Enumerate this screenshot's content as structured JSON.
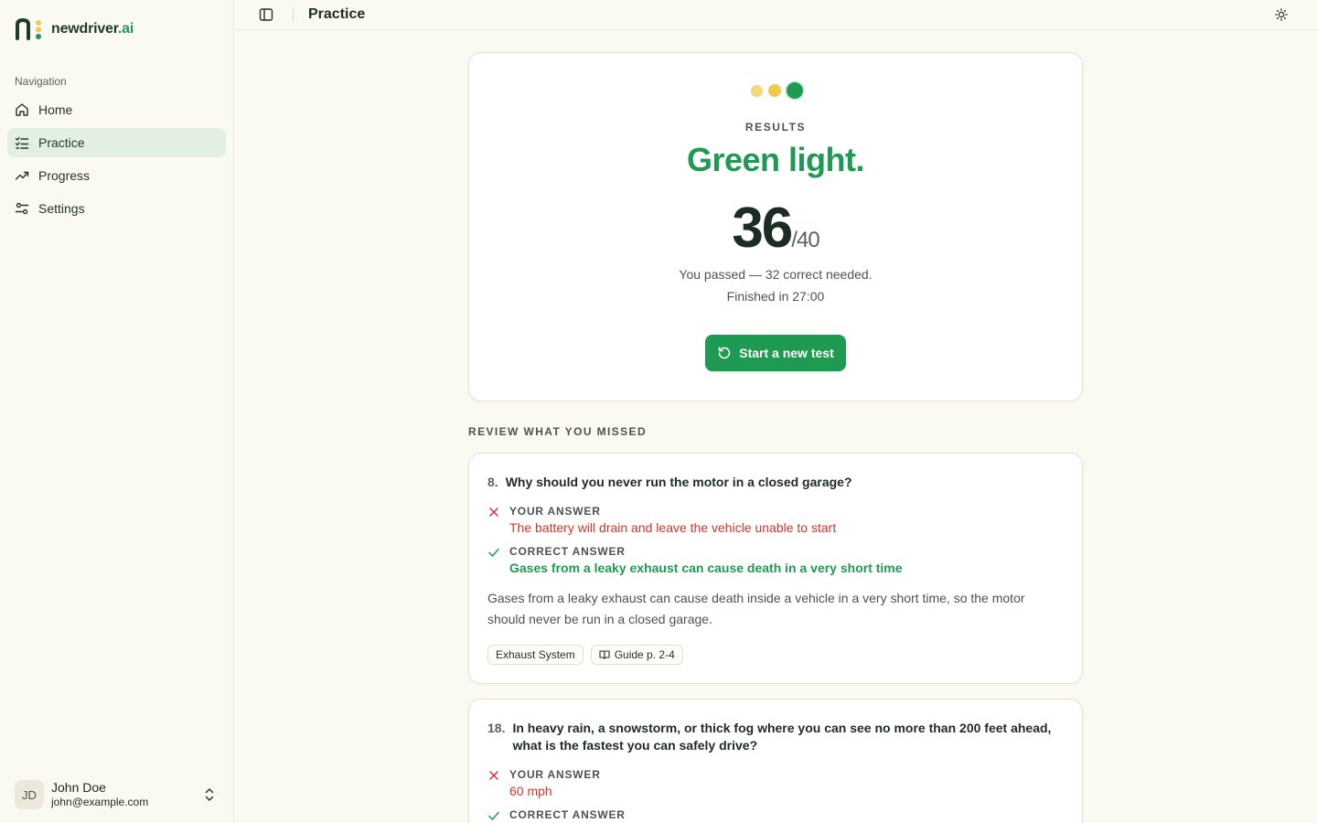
{
  "brand": {
    "name_main": "newdriver",
    "name_suffix": ".ai"
  },
  "sidebar": {
    "heading": "Navigation",
    "items": [
      {
        "label": "Home",
        "icon": "home-icon"
      },
      {
        "label": "Practice",
        "icon": "list-check-icon",
        "active": true
      },
      {
        "label": "Progress",
        "icon": "trending-up-icon"
      },
      {
        "label": "Settings",
        "icon": "sliders-icon"
      }
    ],
    "user": {
      "initials": "JD",
      "name": "John Doe",
      "email": "john@example.com"
    }
  },
  "topbar": {
    "title": "Practice"
  },
  "result": {
    "label": "RESULTS",
    "verdict": "Green light.",
    "score": "36",
    "total": "/40",
    "pass_text": "You passed — 32 correct needed.",
    "time_text": "Finished in 27:00",
    "button_label": "Start a new test"
  },
  "review": {
    "heading": "REVIEW WHAT YOU MISSED",
    "your_answer_label": "YOUR ANSWER",
    "correct_answer_label": "CORRECT ANSWER",
    "questions": [
      {
        "number": "8.",
        "question": "Why should you never run the motor in a closed garage?",
        "your_answer": "The battery will drain and leave the vehicle unable to start",
        "correct_answer": "Gases from a leaky exhaust can cause death in a very short time",
        "explanation": "Gases from a leaky exhaust can cause death inside a vehicle in a very short time, so the motor should never be run in a closed garage.",
        "tags": [
          "Exhaust System",
          "Guide p. 2-4"
        ]
      },
      {
        "number": "18.",
        "question": "In heavy rain, a snowstorm, or thick fog where you can see no more than 200 feet ahead, what is the fastest you can safely drive?",
        "your_answer": "60 mph"
      }
    ]
  },
  "colors": {
    "accent": "#1e9a52",
    "error": "#d0342c",
    "background": "#fbfaf2"
  }
}
